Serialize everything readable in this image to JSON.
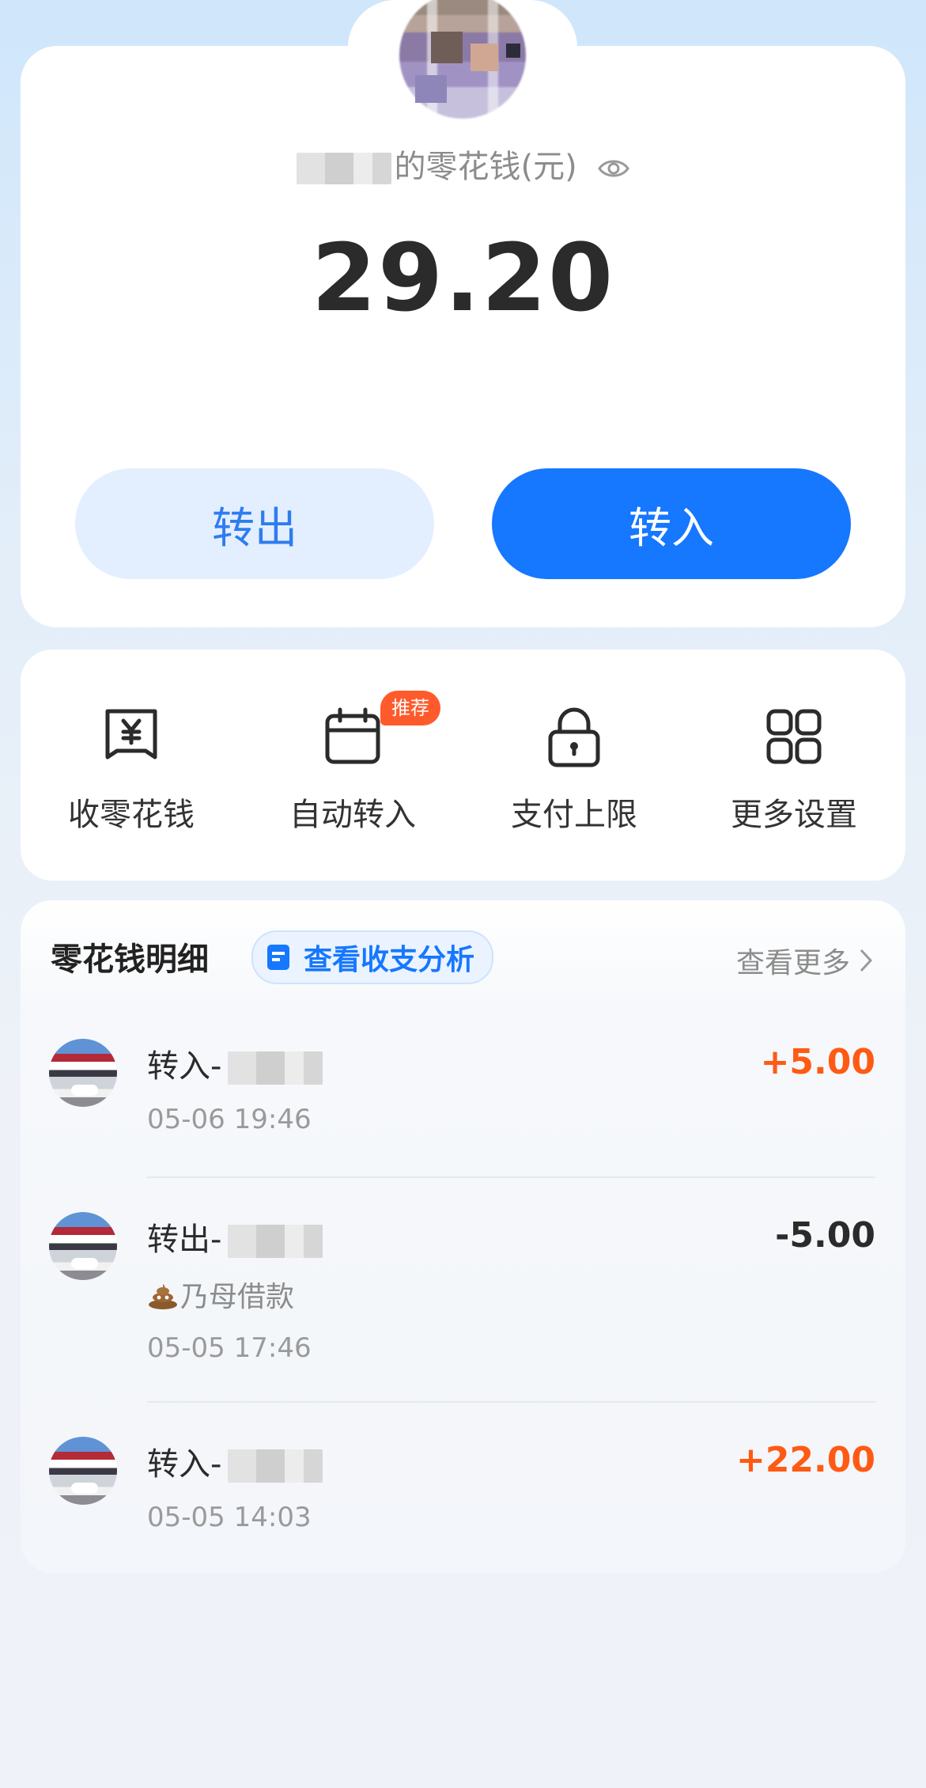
{
  "account": {
    "owner_suffix": "的零花钱(元)",
    "balance": "29.20"
  },
  "buttons": {
    "transfer_out": "转出",
    "transfer_in": "转入"
  },
  "actions": [
    {
      "label": "收零花钱",
      "icon": "yuan-receipt-icon"
    },
    {
      "label": "自动转入",
      "icon": "calendar-icon",
      "badge": "推荐"
    },
    {
      "label": "支付上限",
      "icon": "lock-icon"
    },
    {
      "label": "更多设置",
      "icon": "grid-icon"
    }
  ],
  "details": {
    "title": "零花钱明细",
    "analysis_label": "查看收支分析",
    "view_more": "查看更多",
    "transactions": [
      {
        "name": "转入-",
        "time": "05-06 19:46",
        "amount": "+5.00",
        "direction": "in"
      },
      {
        "name": "转出-",
        "memo": "乃母借款",
        "time": "05-05 17:46",
        "amount": "-5.00",
        "direction": "out"
      },
      {
        "name": "转入-",
        "time": "05-05 14:03",
        "amount": "+22.00",
        "direction": "in"
      }
    ]
  },
  "colors": {
    "accent": "#1677ff",
    "income": "#ff5a14",
    "badge": "#ff5a2b"
  }
}
